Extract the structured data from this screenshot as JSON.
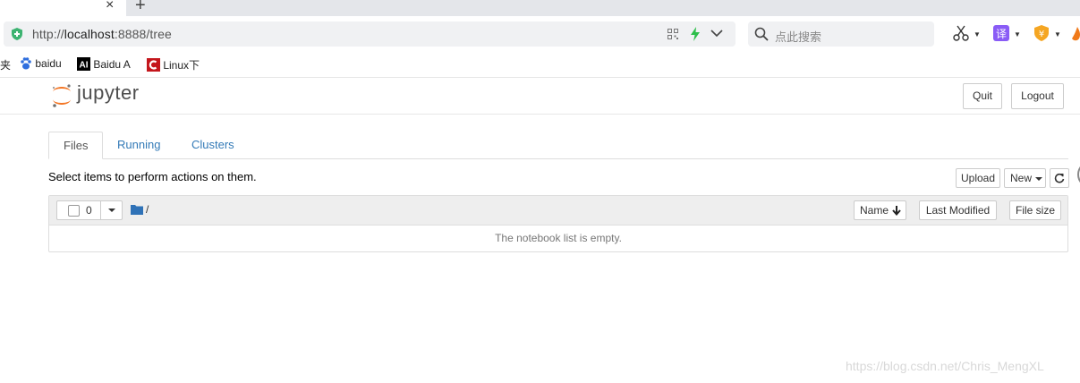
{
  "browser": {
    "tab_close": "×",
    "tab_new": "+",
    "url_scheme": "http://",
    "url_host": "localhost",
    "url_rest": ":8888/tree",
    "search_placeholder": "点此搜索",
    "bookmarks": [
      {
        "label": "夹"
      },
      {
        "label": "baidu"
      },
      {
        "label": "Baidu A"
      },
      {
        "label": "Linux下"
      }
    ]
  },
  "header": {
    "logo_text": "jupyter",
    "quit_label": "Quit",
    "logout_label": "Logout"
  },
  "tabs": [
    {
      "label": "Files",
      "active": true
    },
    {
      "label": "Running",
      "active": false
    },
    {
      "label": "Clusters",
      "active": false
    }
  ],
  "toolbar": {
    "hint": "Select items to perform actions on them.",
    "upload_label": "Upload",
    "new_label": "New"
  },
  "list": {
    "selected_count": "0",
    "path": "/",
    "columns": {
      "name": "Name",
      "last_modified": "Last Modified",
      "file_size": "File size"
    },
    "empty_message": "The notebook list is empty."
  },
  "watermark": "https://blog.csdn.net/Chris_MengXL",
  "colors": {
    "link": "#337ab7",
    "jupyter_orange": "#f37726",
    "shield_green": "#3cb371"
  }
}
